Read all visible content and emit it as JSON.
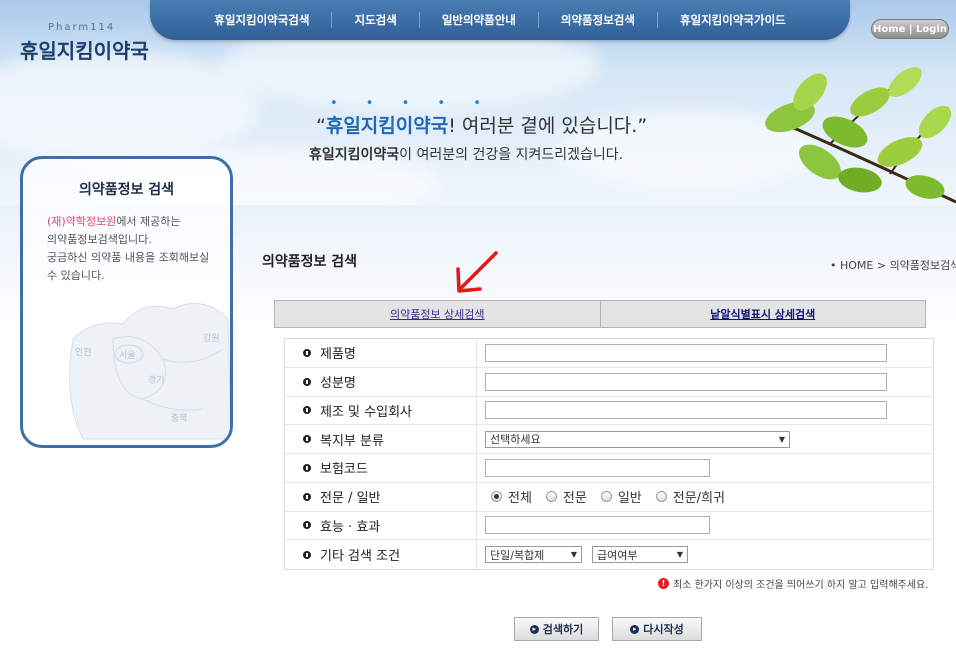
{
  "header": {
    "logo_sub": "Pharm114",
    "logo": "휴일지킴이약국",
    "nav": [
      "휴일지킴이약국검색",
      "지도검색",
      "일반의약품안내",
      "의약품정보검색",
      "휴일지킴이약국가이드"
    ],
    "home_login": "Home | Login"
  },
  "hero": {
    "dots": "• • • • •",
    "slogan_quote_open": "“",
    "slogan_brand": "휴일지킴이약국",
    "slogan_rest": "! 여러분 곁에 있습니다.”",
    "sub_brand": "휴일지킴이약국",
    "sub_rest": "이 여러분의 건강을 지켜드리겠습니다."
  },
  "sidebar": {
    "title": "의약품정보 검색",
    "source": "(재)약학정보원",
    "text_1": "에서 제공하는",
    "text_2": "의약품정보검색입니다.",
    "text_3": "궁금하신 의약품 내용을 조회해보실수 있습니다.",
    "map_labels": [
      "인천",
      "서울",
      "강원",
      "경기",
      "충북"
    ]
  },
  "page": {
    "title": "의약품정보 검색",
    "breadcrumb": "• HOME > 의약품정보검색"
  },
  "tabs": [
    "의약품정보 상세검색",
    "낱알식별표시 상세검색"
  ],
  "form": {
    "rows": [
      {
        "label": "제품명"
      },
      {
        "label": "성분명"
      },
      {
        "label": "제조 및 수입회사"
      },
      {
        "label": "복지부 분류",
        "select": "선택하세요"
      },
      {
        "label": "보험코드"
      },
      {
        "label": "전문 / 일반",
        "radios": [
          "전체",
          "전문",
          "일반",
          "전문/희귀"
        ],
        "selected": "전체"
      },
      {
        "label": "효능 · 효과"
      },
      {
        "label": "기타 검색 조건",
        "selects": [
          "단일/복합제",
          "급여여부"
        ]
      }
    ]
  },
  "note": "최소 한가지 이상의 조건을 띄어쓰기 하지 말고 입력해주세요.",
  "buttons": {
    "search": "검색하기",
    "reset": "다시작성"
  },
  "colors": {
    "nav_bg": "#2f5f97",
    "accent": "#1f67b6",
    "source_pink": "#e2466f",
    "arrow_red": "#e01818"
  }
}
